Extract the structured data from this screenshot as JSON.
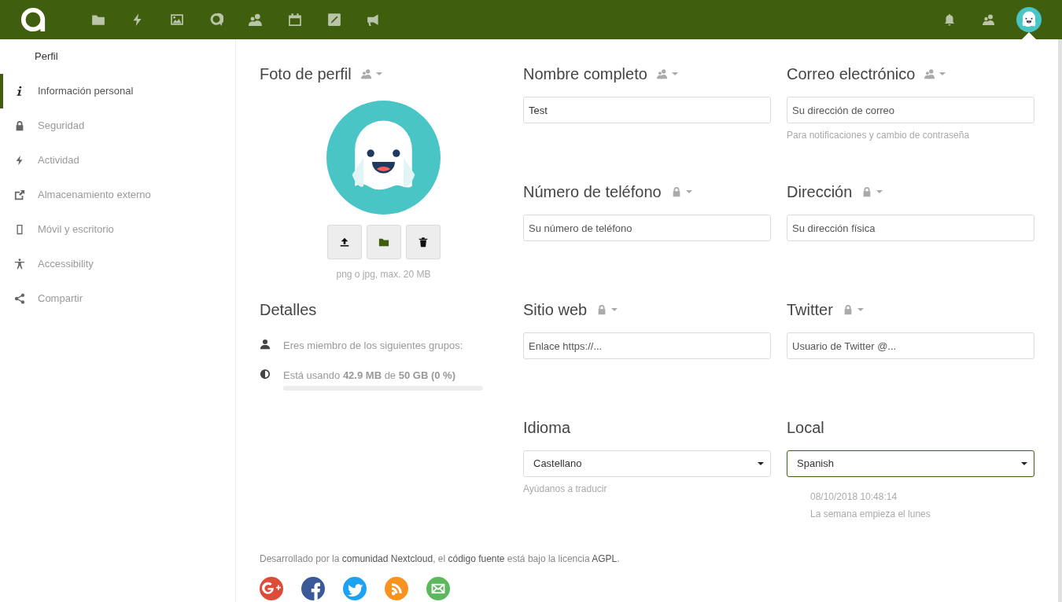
{
  "header": {
    "apps": [
      {
        "kind": "files"
      },
      {
        "kind": "activity"
      },
      {
        "kind": "gallery"
      },
      {
        "kind": "talk"
      },
      {
        "kind": "contacts"
      },
      {
        "kind": "calendar"
      },
      {
        "kind": "notes"
      },
      {
        "kind": "announce"
      }
    ],
    "right": [
      {
        "kind": "bell"
      },
      {
        "kind": "contacts"
      },
      {
        "kind": "avatar"
      }
    ]
  },
  "sidebar": {
    "heading": "Perfil",
    "items": [
      {
        "label": "Información personal",
        "kind": "info",
        "selected": true
      },
      {
        "label": "Seguridad",
        "kind": "lock",
        "selected": false
      },
      {
        "label": "Actividad",
        "kind": "bolt",
        "selected": false
      },
      {
        "label": "Almacenamiento externo",
        "kind": "external",
        "selected": false
      },
      {
        "label": "Móvil y escritorio",
        "kind": "phone",
        "selected": false
      },
      {
        "label": "Accessibility",
        "kind": "accessibility",
        "selected": false
      },
      {
        "label": "Compartir",
        "kind": "share",
        "selected": false
      }
    ]
  },
  "photo": {
    "title": "Foto de perfil",
    "buttons": [
      {
        "kind": "upload"
      },
      {
        "kind": "folder"
      },
      {
        "kind": "delete"
      }
    ],
    "hint": "png o jpg, max. 20 MB"
  },
  "details": {
    "title": "Detalles",
    "items": [
      {
        "kind": "groups",
        "text": "Eres miembro de los siguientes grupos:"
      },
      {
        "kind": "quota",
        "text": "Está usando **42.9 MB** de **50 GB** **(0 %)**",
        "level": 0
      }
    ]
  },
  "columns": [
    [
      {
        "kind": "text",
        "label": "Nombre completo",
        "scope": {
          "kind": "contacts"
        },
        "value": "Test"
      },
      {
        "kind": "text",
        "label": "Número de teléfono",
        "scope": {
          "kind": "lock"
        },
        "placeholder": "Su número de teléfono"
      },
      {
        "kind": "text",
        "label": "Sitio web",
        "scope": {
          "kind": "lock"
        },
        "placeholder": "Enlace https://..."
      },
      {
        "kind": "select",
        "label": "Idioma",
        "value": "Castellano",
        "focused": false,
        "notes": [
          "Ayúdanos a traducir"
        ]
      }
    ],
    [
      {
        "kind": "text",
        "label": "Correo electrónico",
        "scope": {
          "kind": "contacts"
        },
        "placeholder": "Su dirección de correo",
        "notes": [
          "Para notificaciones y cambio de contraseña"
        ]
      },
      {
        "kind": "text",
        "label": "Dirección",
        "scope": {
          "kind": "lock"
        },
        "placeholder": "Su dirección física"
      },
      {
        "kind": "text",
        "label": "Twitter",
        "scope": {
          "kind": "lock"
        },
        "placeholder": "Usuario de Twitter @..."
      },
      {
        "kind": "select",
        "label": "Local",
        "value": "Spanish",
        "focused": true,
        "indent_notes": [
          "08/10/2018 10:48:14",
          "La semana empieza el lunes"
        ]
      }
    ]
  ],
  "footer": {
    "parts": [
      {
        "text": "Desarrollado por la ",
        "link": false
      },
      {
        "text": "comunidad Nextcloud",
        "link": true
      },
      {
        "text": ", el ",
        "link": false
      },
      {
        "text": "código fuente",
        "link": true
      },
      {
        "text": " está bajo la licencia ",
        "link": false
      },
      {
        "text": "AGPL",
        "link": true
      },
      {
        "text": ".",
        "link": false
      }
    ],
    "social": [
      {
        "kind": "gplus",
        "color": "#dd4b39"
      },
      {
        "kind": "facebook",
        "color": "#3b5998"
      },
      {
        "kind": "twitter",
        "color": "#1da1f2"
      },
      {
        "kind": "rss",
        "color": "#f7931e"
      },
      {
        "kind": "mail",
        "color": "#5cb85c"
      }
    ]
  }
}
